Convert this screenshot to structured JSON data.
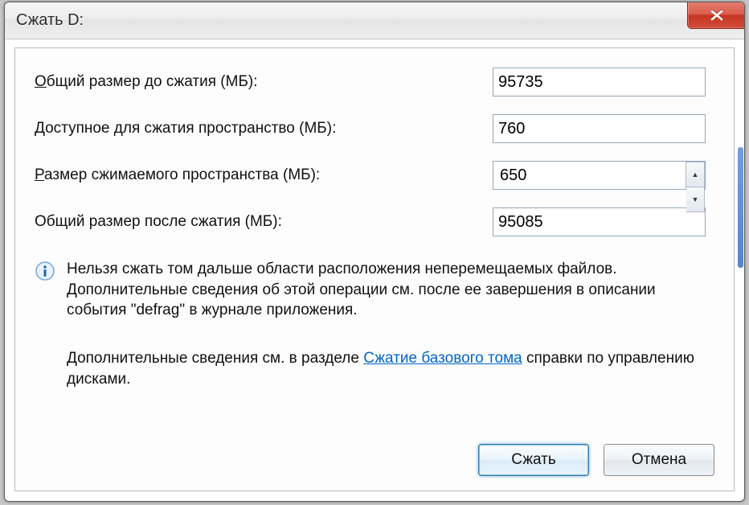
{
  "window": {
    "title": "Сжать D:"
  },
  "labels": {
    "total_before_a": "О",
    "total_before_b": "бщий размер до сжатия (МБ):",
    "available_a": "Д",
    "available_b": "оступное для сжатия пространство (МБ):",
    "shrink_amount_a": "Р",
    "shrink_amount_b": "азмер сжимаемого пространства (МБ):",
    "total_after": "Общий размер после сжатия (МБ):"
  },
  "values": {
    "total_before": "95735",
    "available": "760",
    "shrink_amount": "650",
    "total_after": "95085"
  },
  "info": {
    "text": "Нельзя сжать том дальше области расположения неперемещаемых файлов. Дополнительные сведения об этой операции см. после ее завершения в описании события \"defrag\" в журнале приложения."
  },
  "info2": {
    "prefix": "Дополнительные сведения см. в разделе ",
    "link": "Сжатие базового тома",
    "suffix": " справки по управлению дисками."
  },
  "buttons": {
    "shrink": "Сжать",
    "cancel": "Отмена"
  }
}
